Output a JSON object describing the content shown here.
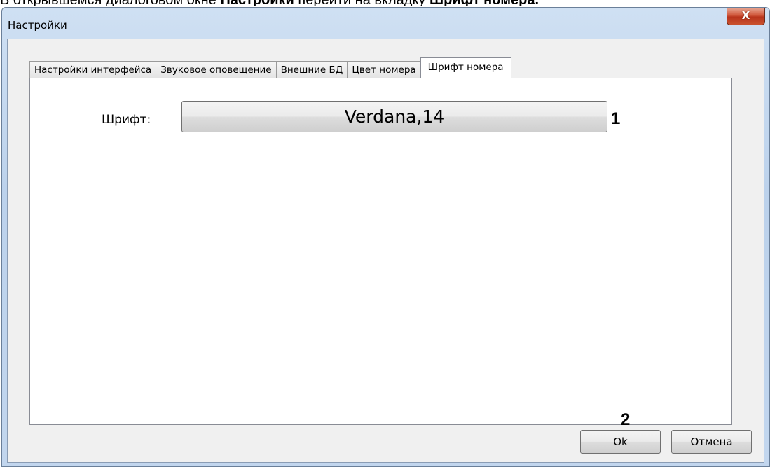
{
  "caption": {
    "prefix": "В открывшемся диалоговом окне ",
    "bold1": "Настройки",
    "middle": " перейти на вкладку ",
    "bold2": "Шрифт номера."
  },
  "window": {
    "title": "Настройки",
    "close_label": "X"
  },
  "tabs": [
    {
      "label": "Настройки интерфейса",
      "active": false
    },
    {
      "label": "Звуковое оповещение",
      "active": false
    },
    {
      "label": "Внешние БД",
      "active": false
    },
    {
      "label": "Цвет номера",
      "active": false
    },
    {
      "label": "Шрифт номера",
      "active": true
    }
  ],
  "panel": {
    "font_label": "Шрифт:",
    "font_value": "Verdana,14"
  },
  "markers": {
    "one": "1",
    "two": "2"
  },
  "buttons": {
    "ok": "Ok",
    "cancel": "Отмена"
  },
  "colors": {
    "close_button": "#c9452a",
    "window_frame": "#bcd2ec",
    "client_bg": "#f0f0f0",
    "panel_bg": "#ffffff"
  }
}
